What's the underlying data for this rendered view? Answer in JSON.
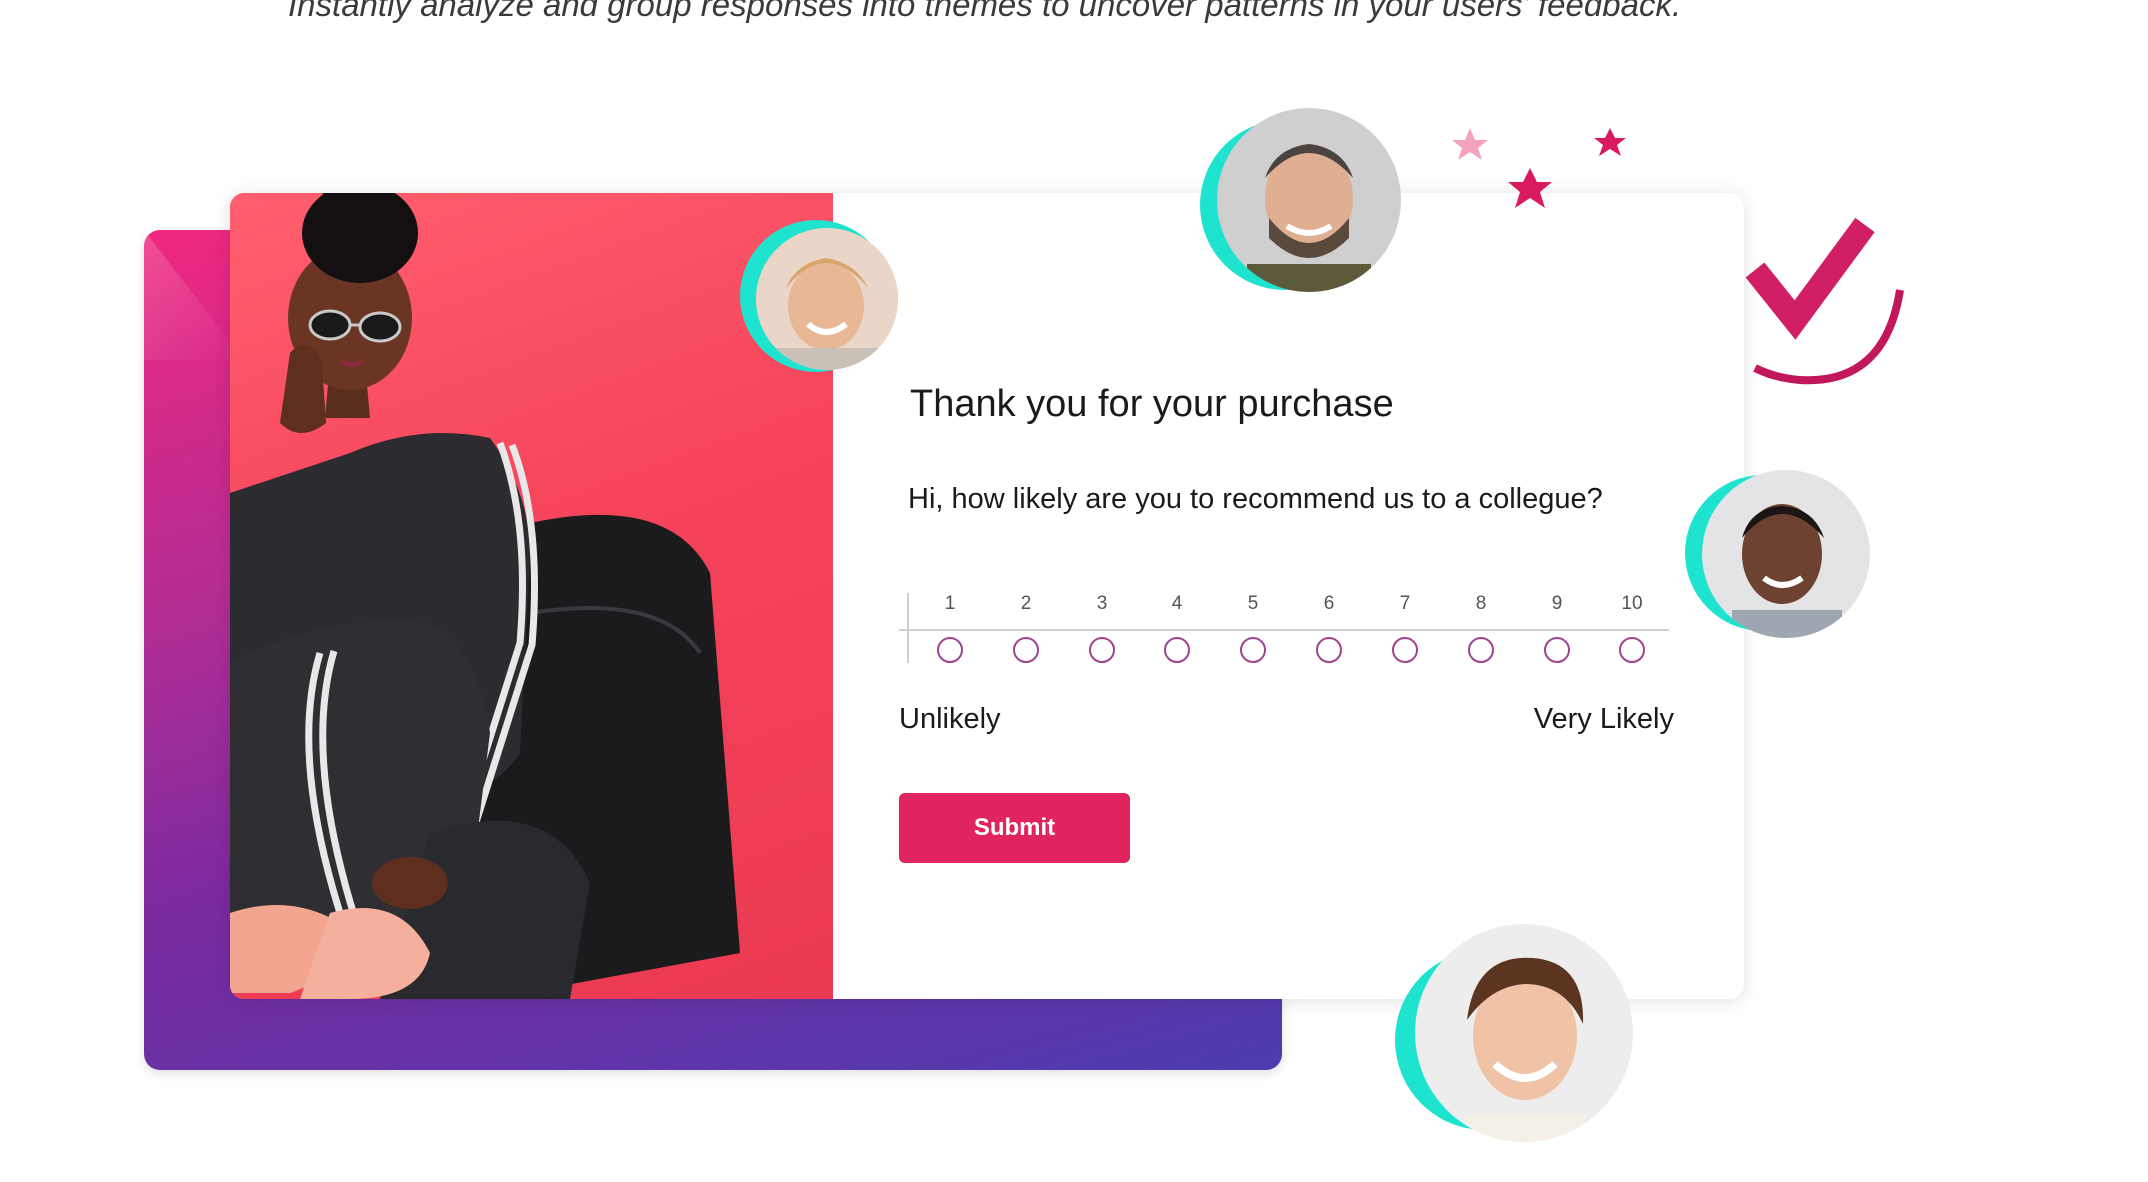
{
  "headline": "Instantly analyze and group responses into themes to uncover patterns in your users' feedback.",
  "survey": {
    "title": "Thank you for your purchase",
    "question": "Hi, how likely are you to recommend us to a collegue?",
    "scale": [
      "1",
      "2",
      "3",
      "4",
      "5",
      "6",
      "7",
      "8",
      "9",
      "10"
    ],
    "low_label": "Unlikely",
    "high_label": "Very Likely",
    "submit_label": "Submit"
  },
  "colors": {
    "accent": "#e0245e",
    "radio": "#a0438f",
    "ring": "#1ee3cf",
    "photo_bg": "#f5435a",
    "backdrop_top": "#f0277f",
    "backdrop_bottom": "#4d3cae"
  },
  "icons": [
    "checkmark-icon",
    "star-icon"
  ]
}
